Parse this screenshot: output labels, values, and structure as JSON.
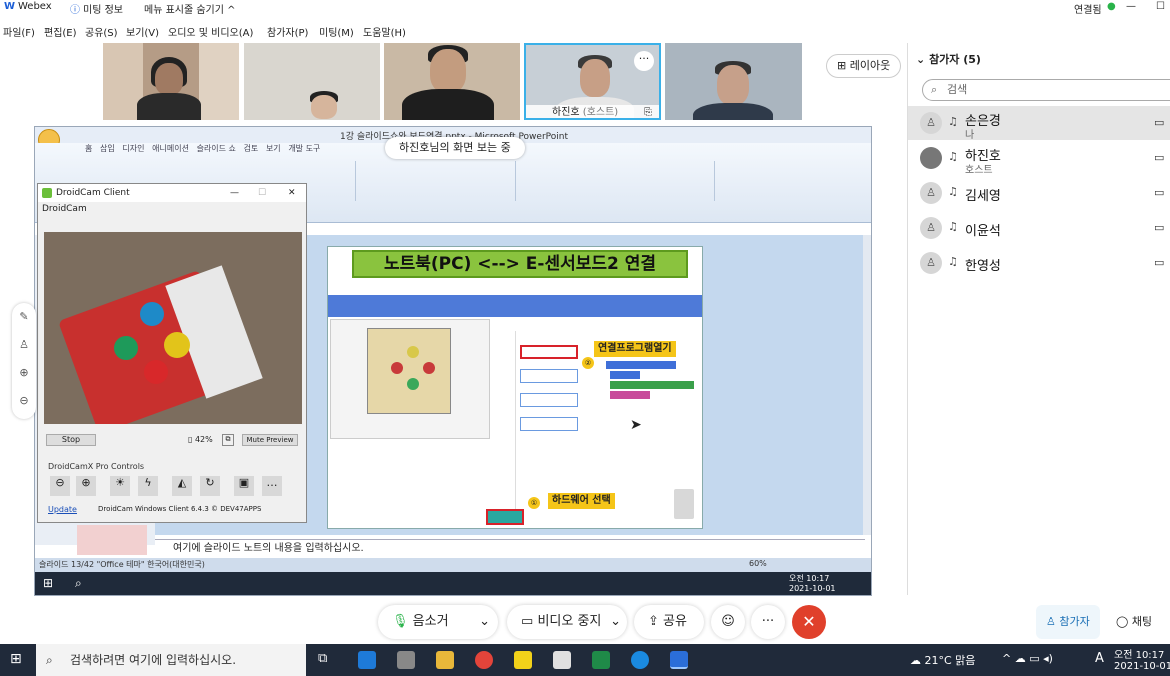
{
  "titlebar": {
    "app_name": "Webex",
    "meeting_info": "미팅 정보",
    "hide_menu": "메뉴 표시줄 숨기기 ^",
    "connection_status": "연결됨"
  },
  "menu": {
    "items": [
      "파일(F)",
      "편집(E)",
      "공유(S)",
      "보기(V)",
      "오디오 및 비디오(A)",
      "참가자(P)",
      "미팅(M)",
      "도움말(H)"
    ]
  },
  "video_strip": {
    "active_name": "하진호",
    "active_role": "(호스트)",
    "layout_label": "레이아웃"
  },
  "shared_screen": {
    "viewing_badge": "하진호님의 화면 보는 중",
    "pp_title": "1강 슬라이드쇼와 보드연결.pptx - Microsoft PowerPoint",
    "ribbon_tabs": [
      "홈",
      "삽입",
      "디자인",
      "애니메이션",
      "슬라이드 쇼",
      "검토",
      "보기",
      "개발 도구"
    ],
    "slide_title": "노트북(PC) <--> E-센서보드2  연결",
    "callout_open": "연결프로그램열기",
    "callout_hardware": "하드웨어 선택",
    "notes_placeholder": "여기에 슬라이드 노트의 내용을 입력하십시오.",
    "status_left": "슬라이드 13/42   \"Office 테마\"   한국어(대한민국)",
    "zoom": "60%",
    "clock_time": "오전 10:17",
    "clock_date": "2021-10-01"
  },
  "droidcam": {
    "title": "DroidCam Client",
    "menu": "DroidCam",
    "stop_label": "Stop",
    "battery": "42%",
    "mute_preview": "Mute Preview",
    "pro_controls": "DroidCamX Pro Controls",
    "update_link": "Update",
    "version": "DroidCam Windows Client 6.4.3 © DEV47APPS"
  },
  "participants": {
    "header": "참가자 (5)",
    "search_placeholder": "검색",
    "list": [
      {
        "name": "손은경",
        "sub": "나"
      },
      {
        "name": "하진호",
        "sub": "호스트"
      },
      {
        "name": "김세영",
        "sub": ""
      },
      {
        "name": "이윤석",
        "sub": ""
      },
      {
        "name": "한영성",
        "sub": ""
      }
    ]
  },
  "controls": {
    "mute": "음소거",
    "video_stop": "비디오 중지",
    "share": "공유",
    "participants_tab": "참가자",
    "chat_tab": "채팅"
  },
  "taskbar": {
    "search_placeholder": "검색하려면 여기에 입력하십시오.",
    "weather": "21°C 맑음",
    "time": "오전 10:17",
    "date": "2021-10-01",
    "ime": "A"
  },
  "colors": {
    "slide_title_bg": "#8ac33e",
    "callout_bg": "#f5c518",
    "end_button": "#e0402b",
    "highlight_red": "#d8222a"
  }
}
